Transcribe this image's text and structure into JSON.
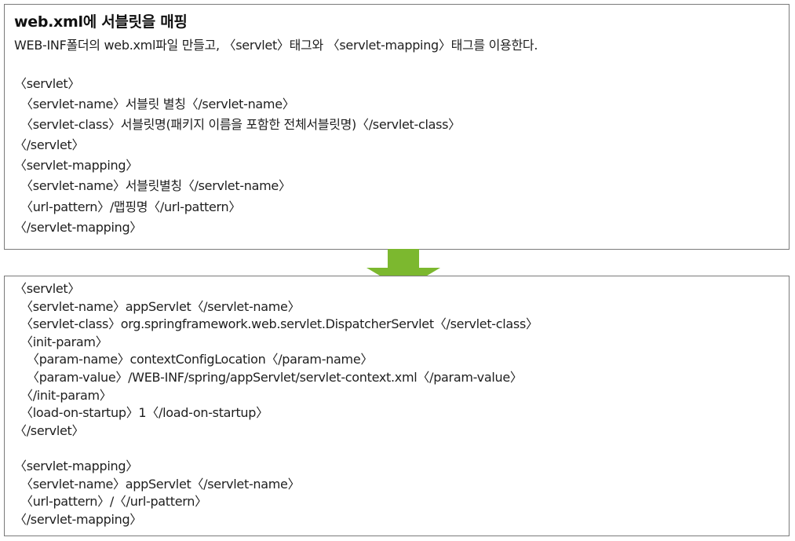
{
  "top_panel": {
    "title": "web.xml에 서블릿을 매핑",
    "description": "WEB-INF폴더의 web.xml파일 만들고, 〈servlet〉태그와 〈servlet-mapping〉태그를 이용한다.",
    "lines": [
      {
        "indent": 0,
        "text": "〈servlet〉"
      },
      {
        "indent": 1,
        "text": "〈servlet-name〉서블릿 별칭〈/servlet-name〉"
      },
      {
        "indent": 1,
        "text": "〈servlet-class〉서블릿명(패키지 이름을 포함한 전체서블릿명)〈/servlet-class〉"
      },
      {
        "indent": 0,
        "text": "〈/servlet〉"
      },
      {
        "indent": 0,
        "text": "〈servlet-mapping〉"
      },
      {
        "indent": 1,
        "text": "〈servlet-name〉서블릿별칭〈/servlet-name〉"
      },
      {
        "indent": 1,
        "text": "〈url-pattern〉/맵핑명〈/url-pattern〉"
      },
      {
        "indent": 0,
        "text": "〈/servlet-mapping〉"
      }
    ]
  },
  "arrow": {
    "icon": "down-arrow-icon",
    "color": "#7cb82f"
  },
  "bottom_panel": {
    "lines": [
      {
        "indent": 0,
        "text": "〈servlet〉"
      },
      {
        "indent": 1,
        "text": "〈servlet-name〉appServlet〈/servlet-name〉"
      },
      {
        "indent": 1,
        "text": "〈servlet-class〉org.springframework.web.servlet.DispatcherServlet〈/servlet-class〉"
      },
      {
        "indent": 1,
        "text": "〈init-param〉"
      },
      {
        "indent": 2,
        "text": "〈param-name〉contextConfigLocation〈/param-name〉"
      },
      {
        "indent": 2,
        "text": "〈param-value〉/WEB-INF/spring/appServlet/servlet-context.xml〈/param-value〉"
      },
      {
        "indent": 1,
        "text": "〈/init-param〉"
      },
      {
        "indent": 1,
        "text": "〈load-on-startup〉1〈/load-on-startup〉"
      },
      {
        "indent": 0,
        "text": "〈/servlet〉"
      },
      {
        "indent": 0,
        "text": ""
      },
      {
        "indent": 0,
        "text": "〈servlet-mapping〉"
      },
      {
        "indent": 1,
        "text": "〈servlet-name〉appServlet〈/servlet-name〉"
      },
      {
        "indent": 1,
        "text": "〈url-pattern〉/〈/url-pattern〉"
      },
      {
        "indent": 0,
        "text": "〈/servlet-mapping〉"
      }
    ]
  }
}
